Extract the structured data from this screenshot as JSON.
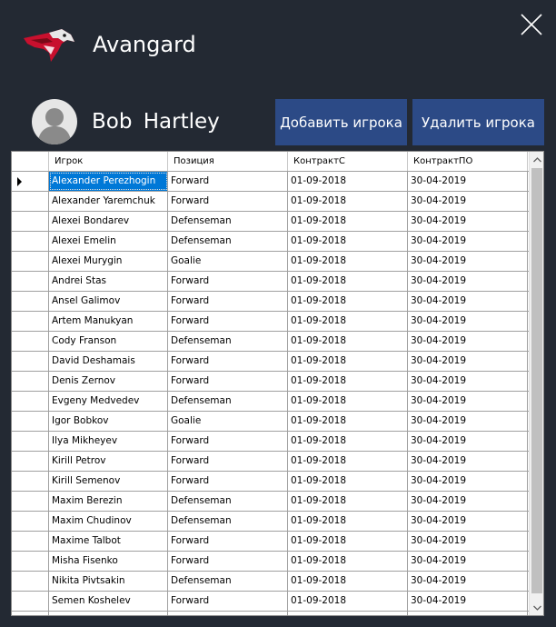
{
  "app": {
    "title": "Avangard",
    "logo_icon": "hawk-logo-icon",
    "close_icon": "close-icon"
  },
  "user": {
    "name": "Bob  Hartley",
    "avatar_icon": "user-avatar-icon"
  },
  "toolbar": {
    "add_label": "Добавить игрока",
    "delete_label": "Удалить игрока"
  },
  "colors": {
    "background": "#232933",
    "button": "#2c4a86",
    "selection": "#0078d7",
    "logo_red": "#c8102e"
  },
  "table": {
    "columns": [
      "Игрок",
      "Позиция",
      "КонтрактС",
      "КонтрактПО"
    ],
    "selected_row": 0,
    "rows": [
      [
        "Alexander Perezhogin",
        "Forward",
        "01-09-2018",
        "30-04-2019"
      ],
      [
        "Alexander Yaremchuk",
        "Forward",
        "01-09-2018",
        "30-04-2019"
      ],
      [
        "Alexei Bondarev",
        "Defenseman",
        "01-09-2018",
        "30-04-2019"
      ],
      [
        "Alexei Emelin",
        "Defenseman",
        "01-09-2018",
        "30-04-2019"
      ],
      [
        "Alexei Murygin",
        "Goalie",
        "01-09-2018",
        "30-04-2019"
      ],
      [
        "Andrei Stas",
        "Forward",
        "01-09-2018",
        "30-04-2019"
      ],
      [
        "Ansel Galimov",
        "Forward",
        "01-09-2018",
        "30-04-2019"
      ],
      [
        "Artem Manukyan",
        "Forward",
        "01-09-2018",
        "30-04-2019"
      ],
      [
        "Cody Franson",
        "Defenseman",
        "01-09-2018",
        "30-04-2019"
      ],
      [
        "David Deshamais",
        "Forward",
        "01-09-2018",
        "30-04-2019"
      ],
      [
        "Denis Zernov",
        "Forward",
        "01-09-2018",
        "30-04-2019"
      ],
      [
        "Evgeny Medvedev",
        "Defenseman",
        "01-09-2018",
        "30-04-2019"
      ],
      [
        "Igor Bobkov",
        "Goalie",
        "01-09-2018",
        "30-04-2019"
      ],
      [
        "Ilya Mikheyev",
        "Forward",
        "01-09-2018",
        "30-04-2019"
      ],
      [
        "Kirill Petrov",
        "Forward",
        "01-09-2018",
        "30-04-2019"
      ],
      [
        "Kirill Semenov",
        "Forward",
        "01-09-2018",
        "30-04-2019"
      ],
      [
        "Maxim Berezin",
        "Defenseman",
        "01-09-2018",
        "30-04-2019"
      ],
      [
        "Maxim Chudinov",
        "Defenseman",
        "01-09-2018",
        "30-04-2019"
      ],
      [
        "Maxime Talbot",
        "Forward",
        "01-09-2018",
        "30-04-2019"
      ],
      [
        "Misha Fisenko",
        "Forward",
        "01-09-2018",
        "30-04-2019"
      ],
      [
        "Nikita Pivtsakin",
        "Defenseman",
        "01-09-2018",
        "30-04-2019"
      ],
      [
        "Semen Koshelev",
        "Forward",
        "01-09-2018",
        "30-04-2019"
      ],
      [
        "",
        "",
        "",
        ""
      ]
    ]
  }
}
